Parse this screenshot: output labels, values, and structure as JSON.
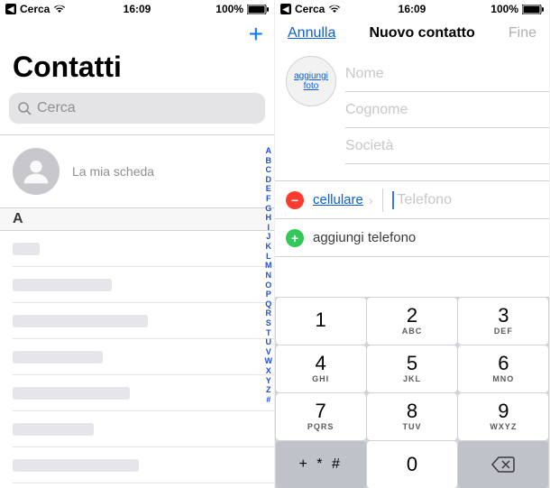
{
  "status": {
    "back": "Cerca",
    "time": "16:09",
    "battery": "100%"
  },
  "left": {
    "title": "Contatti",
    "search_placeholder": "Cerca",
    "my_card": "La mia scheda",
    "section": "A",
    "index": [
      "A",
      "B",
      "C",
      "D",
      "E",
      "F",
      "G",
      "H",
      "I",
      "J",
      "K",
      "L",
      "M",
      "N",
      "O",
      "P",
      "Q",
      "R",
      "S",
      "T",
      "U",
      "V",
      "W",
      "X",
      "Y",
      "Z",
      "#"
    ]
  },
  "right": {
    "cancel": "Annulla",
    "title": "Nuovo contatto",
    "done": "Fine",
    "add_photo": "aggiungi foto",
    "fields": {
      "name": "Nome",
      "surname": "Cognome",
      "company": "Società"
    },
    "phone_type": "cellulare",
    "phone_placeholder": "Telefono",
    "add_phone": "aggiungi telefono"
  },
  "keypad": {
    "r1": [
      {
        "n": "1",
        "l": ""
      },
      {
        "n": "2",
        "l": "ABC"
      },
      {
        "n": "3",
        "l": "DEF"
      }
    ],
    "r2": [
      {
        "n": "4",
        "l": "GHI"
      },
      {
        "n": "5",
        "l": "JKL"
      },
      {
        "n": "6",
        "l": "MNO"
      }
    ],
    "r3": [
      {
        "n": "7",
        "l": "PQRS"
      },
      {
        "n": "8",
        "l": "TUV"
      },
      {
        "n": "9",
        "l": "WXYZ"
      }
    ],
    "r4": {
      "sym": "+ * #",
      "zero": "0"
    }
  }
}
